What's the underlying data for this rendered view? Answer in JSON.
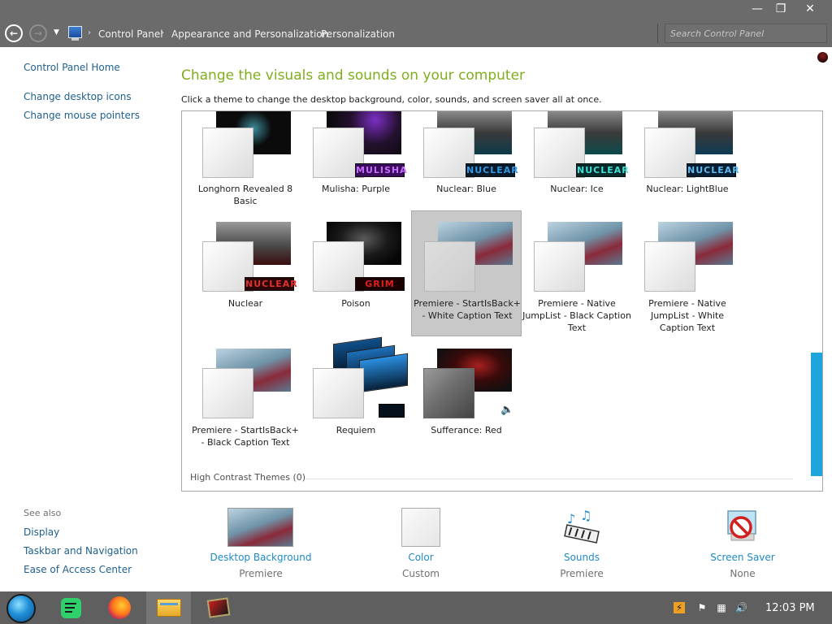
{
  "window": {
    "minimize_glyph": "—",
    "maximize_glyph": "❐",
    "close_glyph": "✕"
  },
  "address": {
    "breadcrumbs": [
      "Control Panel",
      "Appearance and Personalization",
      "Personalization"
    ],
    "separator": "›",
    "search_placeholder": "Search Control Panel",
    "back_glyph": "←",
    "forward_glyph": "→",
    "recent_glyph": "▼"
  },
  "left_pane": {
    "home": "Control Panel Home",
    "links": [
      "Change desktop icons",
      "Change mouse pointers"
    ],
    "see_also_title": "See also",
    "see_also": [
      "Display",
      "Taskbar and Navigation",
      "Ease of Access Center"
    ]
  },
  "header": {
    "title": "Change the visuals and sounds on your computer",
    "subtitle": "Click a theme to change the desktop background, color, sounds, and screen saver all at once."
  },
  "themes": [
    {
      "label": "Longhorn Revealed 8 Basic",
      "badge": ""
    },
    {
      "label": "Mulisha: Purple",
      "badge": "MULISHA"
    },
    {
      "label": "Nuclear: Blue",
      "badge": "NUCLEAR"
    },
    {
      "label": "Nuclear: Ice",
      "badge": "NUCLEAR"
    },
    {
      "label": "Nuclear: LightBlue",
      "badge": "NUCLEAR"
    },
    {
      "label": "Nuclear",
      "badge": "NUCLEAR"
    },
    {
      "label": "Poison",
      "badge": "GRIM"
    },
    {
      "label": "Premiere - StartIsBack+ - White Caption Text",
      "badge": "",
      "selected": true
    },
    {
      "label": "Premiere - Native JumpList - Black Caption Text",
      "badge": ""
    },
    {
      "label": "Premiere - Native JumpList - White Caption Text",
      "badge": ""
    },
    {
      "label": "Premiere - StartIsBack+ - Black Caption Text",
      "badge": ""
    },
    {
      "label": "Requiem",
      "badge": ""
    },
    {
      "label": "Sufferance: Red",
      "badge": ""
    }
  ],
  "high_contrast_header": "High Contrast Themes (0)",
  "settings": [
    {
      "name": "Desktop Background",
      "value": "Premiere"
    },
    {
      "name": "Color",
      "value": "Custom"
    },
    {
      "name": "Sounds",
      "value": "Premiere"
    },
    {
      "name": "Screen Saver",
      "value": "None"
    }
  ],
  "taskbar": {
    "clock": "12:03 PM",
    "pinned": [
      "spotify-icon",
      "firefox-icon",
      "file-explorer-icon",
      "media-player-icon"
    ]
  },
  "colors": {
    "title_green": "#7fae1c",
    "link_blue": "#1e5f8c",
    "accent_cyan": "#1da5dc",
    "chrome_gray": "#6b6b6b",
    "taskbar_gray": "#5f5f5f"
  }
}
